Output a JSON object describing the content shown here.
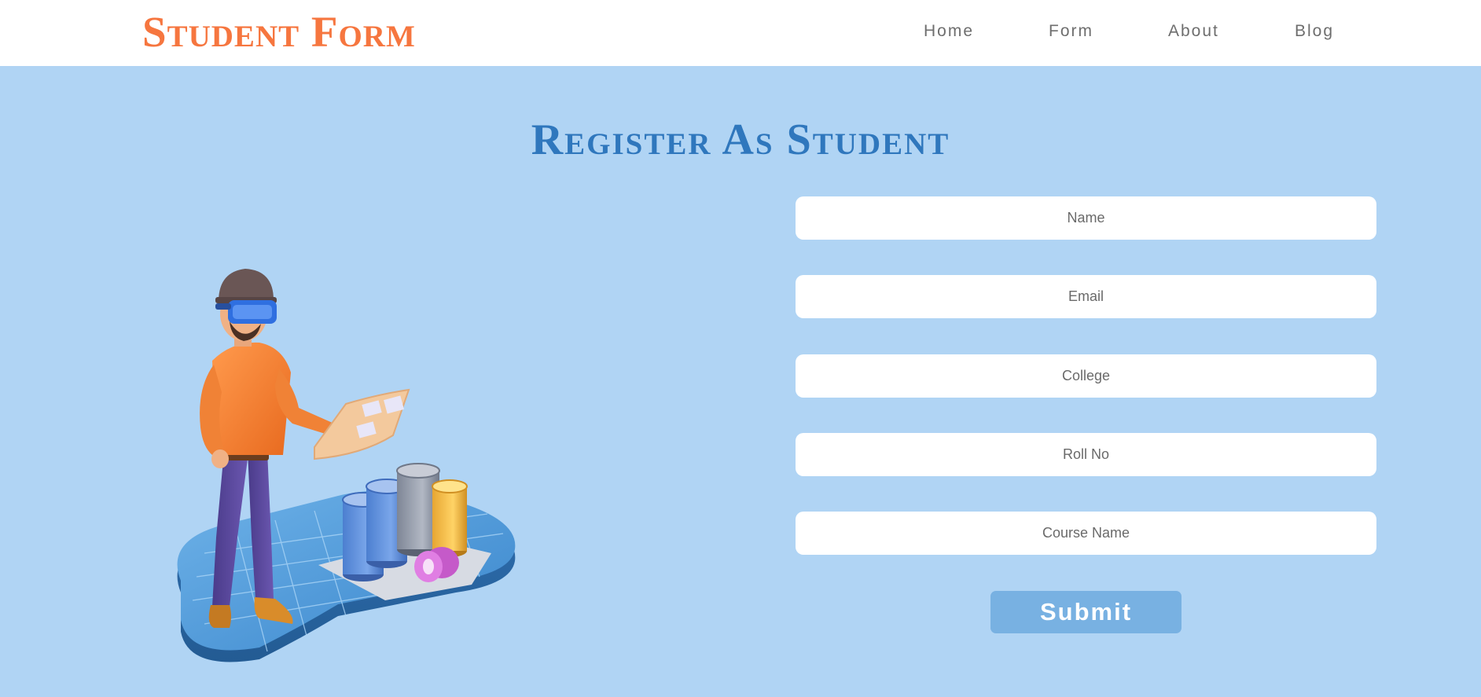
{
  "navbar": {
    "brand": "Student Form",
    "links": [
      {
        "label": "Home"
      },
      {
        "label": "Form"
      },
      {
        "label": "About"
      },
      {
        "label": "Blog"
      }
    ]
  },
  "main": {
    "heading": "Register As Student",
    "illustration_icon": "person-with-vr-headset-and-charts-illustration",
    "form": {
      "fields": [
        {
          "placeholder": "Name",
          "value": ""
        },
        {
          "placeholder": "Email",
          "value": ""
        },
        {
          "placeholder": "College",
          "value": ""
        },
        {
          "placeholder": "Roll No",
          "value": ""
        },
        {
          "placeholder": "Course Name",
          "value": ""
        }
      ],
      "submit_label": "Submit"
    }
  },
  "colors": {
    "brand": "#f6763f",
    "heading": "#2f77bd",
    "background": "#b0d4f4",
    "submit": "#78b1e2",
    "nav_text": "#6e6e6e"
  }
}
